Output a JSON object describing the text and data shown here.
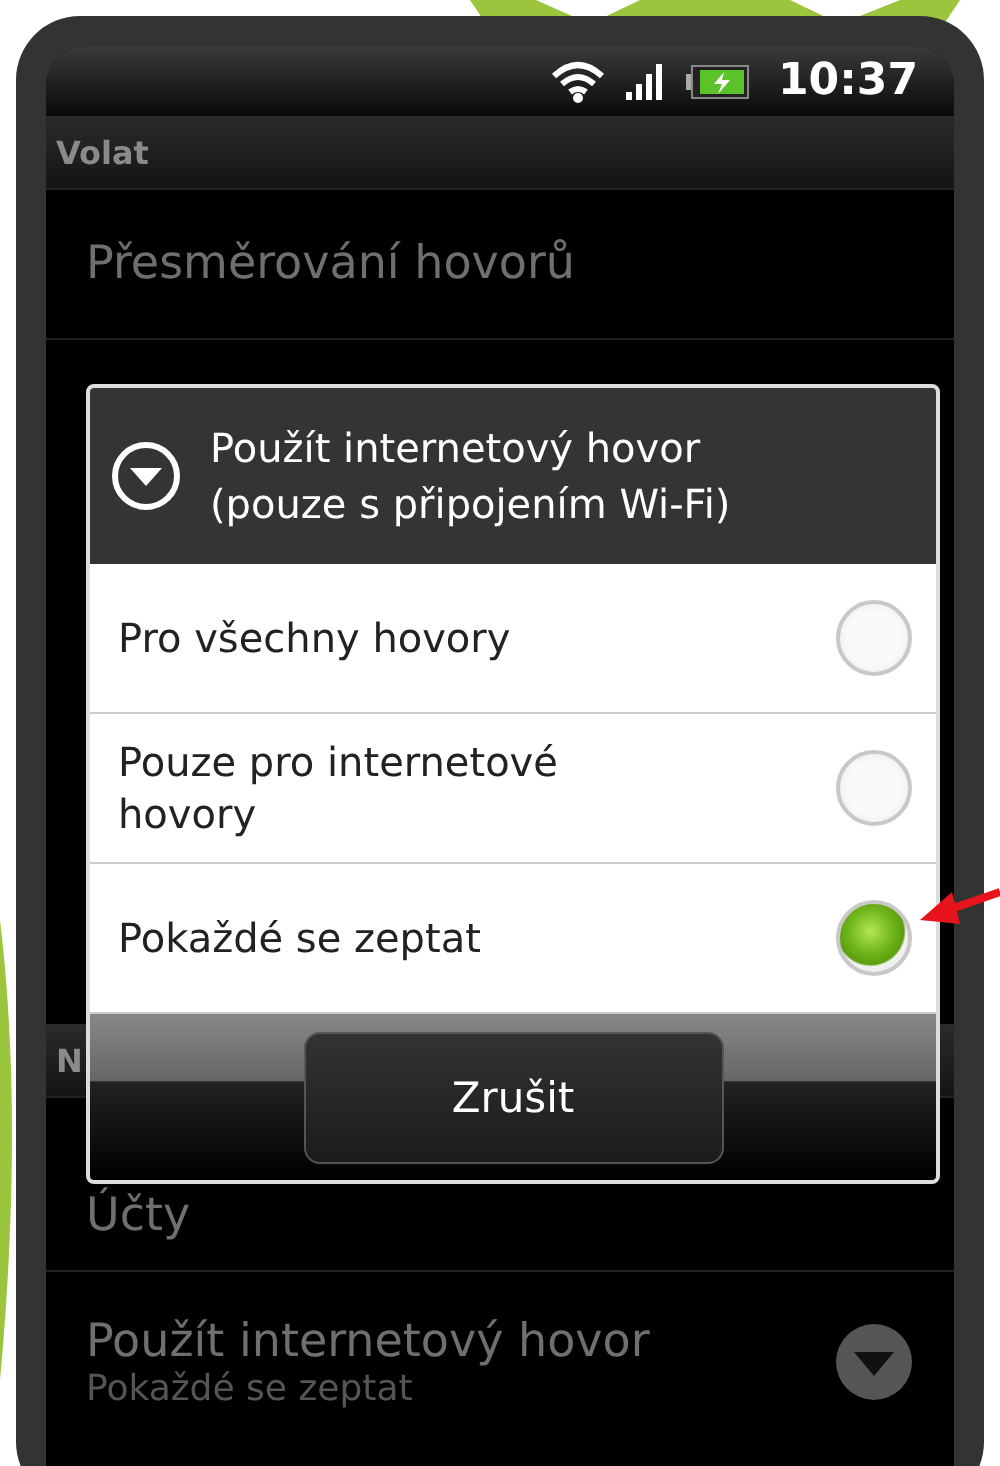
{
  "status_bar": {
    "time": "10:37"
  },
  "settings": [
    {
      "kind": "header",
      "title": "Volat"
    },
    {
      "kind": "item",
      "title": "Přesměrování hovorů"
    },
    {
      "kind": "gap"
    },
    {
      "kind": "header",
      "title": "N"
    },
    {
      "kind": "item",
      "title": "Účty"
    },
    {
      "kind": "dropdown",
      "title": "Použít internetový hovor",
      "summary": "Pokaždé se zeptat"
    }
  ],
  "dialog": {
    "title": "Použít internetový hovor (pouze s připojením Wi-Fi)",
    "options": [
      {
        "label": "Pro všechny hovory",
        "selected": false
      },
      {
        "label": "Pouze pro internetové hovory",
        "selected": false
      },
      {
        "label": "Pokaždé se zeptat",
        "selected": true
      }
    ],
    "button": "Zrušit"
  }
}
